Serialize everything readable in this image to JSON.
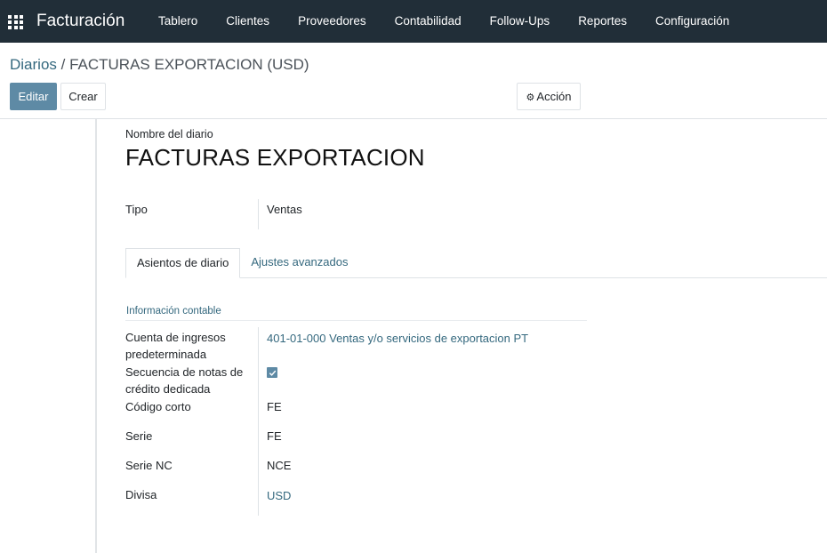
{
  "navbar": {
    "brand": "Facturación",
    "menu": [
      {
        "label": "Tablero"
      },
      {
        "label": "Clientes"
      },
      {
        "label": "Proveedores"
      },
      {
        "label": "Contabilidad"
      },
      {
        "label": "Follow-Ups"
      },
      {
        "label": "Reportes"
      },
      {
        "label": "Configuración"
      }
    ]
  },
  "breadcrumb": {
    "parent": "Diarios",
    "separator": " / ",
    "current": "FACTURAS EXPORTACION (USD)"
  },
  "toolbar": {
    "edit_label": "Editar",
    "create_label": "Crear",
    "action_label": "Acción"
  },
  "form": {
    "name_label": "Nombre del diario",
    "name_value": "FACTURAS EXPORTACION",
    "type_label": "Tipo",
    "type_value": "Ventas",
    "tabs": [
      {
        "label": "Asientos de diario",
        "active": true
      },
      {
        "label": "Ajustes avanzados",
        "active": false
      }
    ],
    "group_title": "Información contable",
    "fields": {
      "income_account_label": "Cuenta de ingresos predeterminada",
      "income_account_value": "401-01-000 Ventas y/o servicios de exportacion PT",
      "refund_sequence_label": "Secuencia de notas de crédito dedicada",
      "refund_sequence_checked": true,
      "short_code_label": "Código corto",
      "short_code_value": "FE",
      "series_label": "Serie",
      "series_value": "FE",
      "series_nc_label": "Serie NC",
      "series_nc_value": "NCE",
      "currency_label": "Divisa",
      "currency_value": "USD"
    }
  },
  "colors": {
    "navbar_bg": "#212e38",
    "primary": "#5e8aa5",
    "link": "#34687e"
  }
}
